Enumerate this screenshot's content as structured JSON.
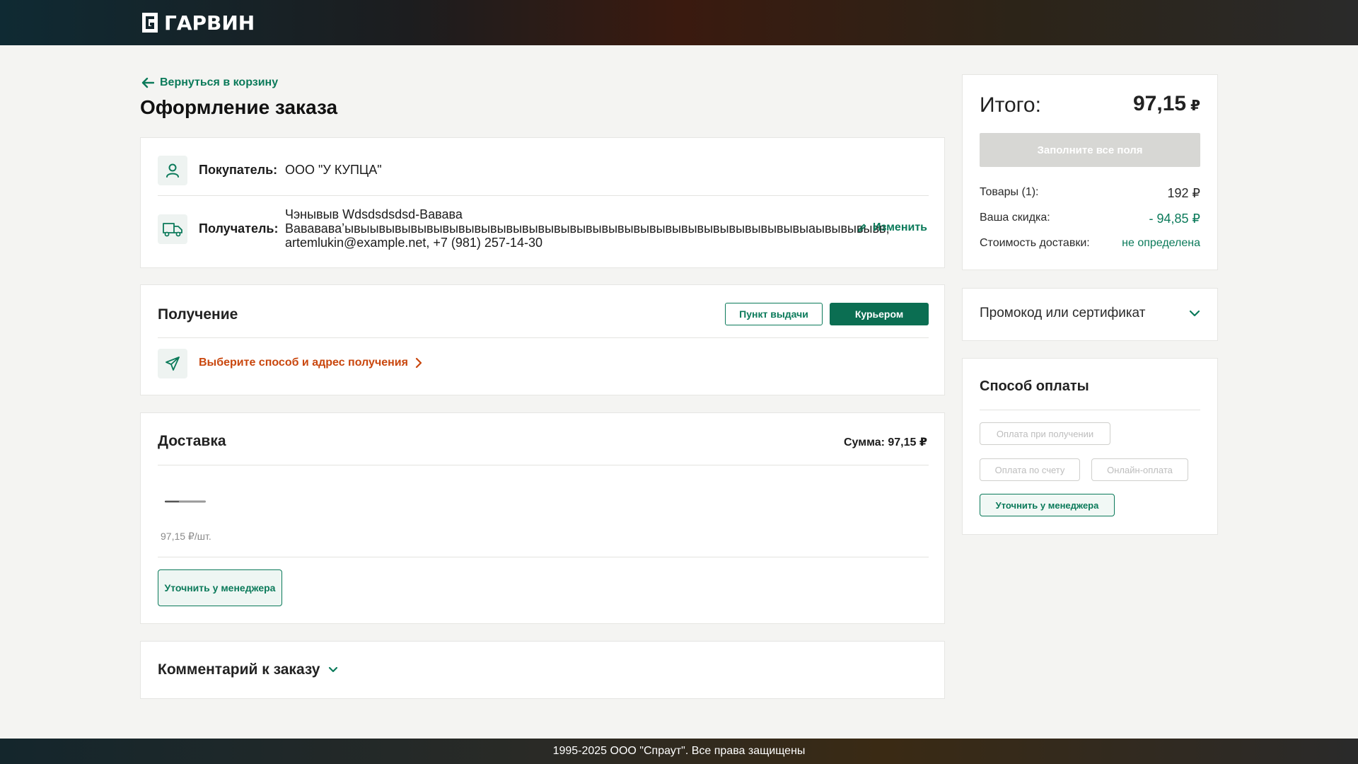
{
  "header": {
    "logo_text": "ГАРВИН"
  },
  "nav": {
    "back_label": "Вернуться в корзину"
  },
  "page": {
    "title": "Оформление заказа"
  },
  "buyer": {
    "label": "Покупатель:",
    "value": "ООО \"У КУПЦА\""
  },
  "recipient": {
    "label": "Получатель:",
    "line1": "Чэнывыв Wdsdsdsdsd-Вавава",
    "line2": "Вавававаʼывыывывывывывывывывывывывывывывывывывывывывывывывывывывывыаывывывывв,",
    "line3": "artemlukin@example.net, +7 (981) 257-14-30",
    "edit_label": "Изменить"
  },
  "receiving": {
    "title": "Получение",
    "btn_pickup": "Пункт выдачи",
    "btn_courier": "Курьером",
    "choose_label": "Выберите способ и адрес получения"
  },
  "delivery": {
    "title": "Доставка",
    "sum_label": "Сумма: 97,15 ₽",
    "unit_price": "97,15 ₽/шт.",
    "manager_btn": "Уточнить у менеджера"
  },
  "comment": {
    "label": "Комментарий к заказу"
  },
  "summary": {
    "total_label": "Итого:",
    "total_value": "97,15",
    "currency": "₽",
    "submit_label": "Заполните все поля",
    "goods_label": "Товары (1):",
    "goods_value": "192 ₽",
    "discount_label": "Ваша скидка:",
    "discount_value": "- 94,85 ₽",
    "shipping_label": "Стоимость доставки:",
    "shipping_value": "не определена"
  },
  "promo": {
    "label": "Промокод или сертификат"
  },
  "payment": {
    "title": "Способ оплаты",
    "options": [
      "Оплата при получении",
      "Оплата по счету",
      "Онлайн-оплата",
      "Уточнить у менеджера"
    ]
  },
  "footer": {
    "copyright": "1995-2025 ООО \"Спраут\". Все права защищены"
  },
  "colors": {
    "brand_green": "#0b7a5a",
    "accent_orange": "#c9470e"
  }
}
